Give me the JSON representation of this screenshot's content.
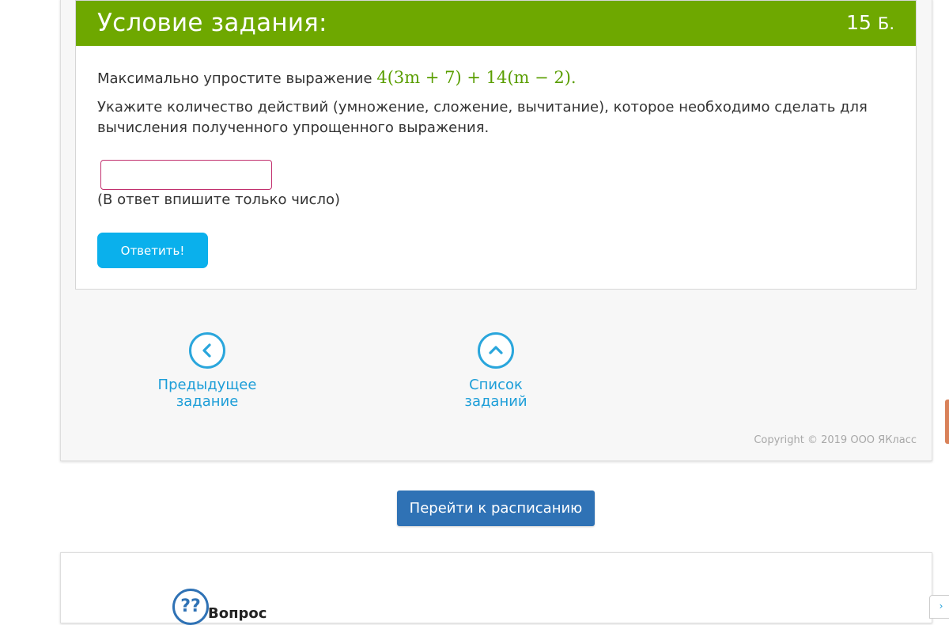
{
  "task": {
    "header_title": "Условие задания:",
    "points_value": "15",
    "points_unit": "Б.",
    "problem_prefix": "Максимально упростите выражение",
    "formula": "4(3m + 7) + 14(m − 2).",
    "instruction": "Укажите количество действий (умножение, сложение, вычитание), которое необходимо сделать для вычисления полученного упрощенного выражения.",
    "answer_value": "",
    "answer_hint": "(В ответ впишите только число)",
    "submit_label": "Ответить!"
  },
  "navigation": {
    "prev_label": "Предыдущее задание",
    "list_label": "Список заданий"
  },
  "footer": {
    "copyright": "Copyright © 2019 ООО ЯКласс"
  },
  "schedule_button_label": "Перейти к расписанию",
  "bottom_card": {
    "help_icon_text": "??",
    "title": "Вопрос"
  },
  "colors": {
    "header_green": "#6ea800",
    "formula_green": "#5a9e00",
    "submit_blue": "#0ab0ec",
    "nav_blue": "#1d9ed8",
    "schedule_blue": "#2f72b5",
    "input_border": "#c2306e"
  },
  "icons": {
    "prev": "chevron-left-circle-icon",
    "list": "chevron-up-circle-icon",
    "help": "question-circle-icon"
  }
}
